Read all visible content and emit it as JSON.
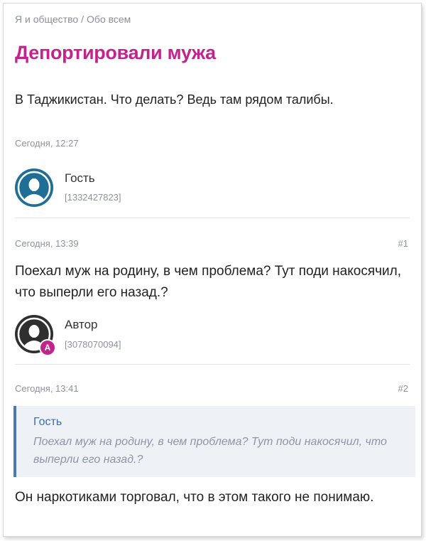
{
  "breadcrumb": {
    "items": [
      "Я и общество",
      "Обо всем"
    ],
    "separator": "/"
  },
  "topic": {
    "title": "Депортировали мужа",
    "text": "В Таджикистан. Что делать? Ведь там рядом талибы.",
    "time": "Сегодня, 12:27",
    "author": {
      "name": "Гость",
      "id": "[1332427823]",
      "avatar_icon": "user-silhouette-icon",
      "avatar_color": "#1f6e96"
    }
  },
  "replies": [
    {
      "time": "Сегодня, 13:39",
      "number": "#1",
      "text": "Поехал муж на родину, в чем проблема? Тут поди накосячил, что выперли его назад.?",
      "author": {
        "name": "Автор",
        "id": "[3078070094]",
        "badge": "A",
        "avatar_icon": "user-silhouette-icon",
        "avatar_color": "#2f2f2f"
      }
    },
    {
      "time": "Сегодня, 13:41",
      "number": "#2",
      "quote": {
        "author": "Гость",
        "text": "Поехал муж на родину, в чем проблема? Тут поди накосячил, что выперли его назад.?"
      },
      "text": "Он наркотиками торговал, что в этом такого не понимаю."
    }
  ],
  "colors": {
    "title": "#c2238c",
    "quote_border": "#4a78b8",
    "quote_author": "#3a6fb5",
    "badge": "#c2238c"
  }
}
